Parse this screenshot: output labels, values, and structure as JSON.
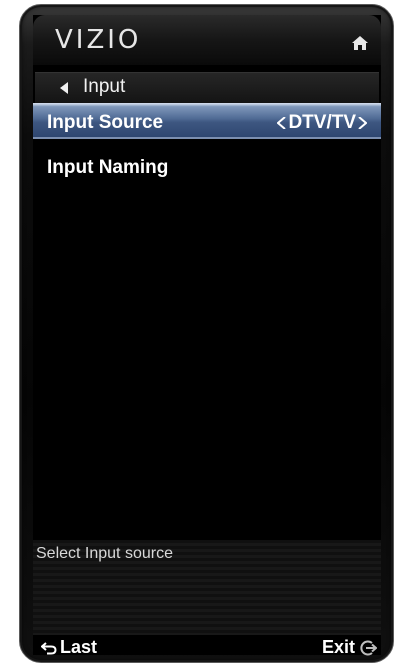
{
  "header": {
    "brand": "VIZIO",
    "home_icon": "home-icon"
  },
  "breadcrumb": {
    "back_icon": "back-arrow-icon",
    "title": "Input"
  },
  "menu": {
    "items": [
      {
        "label": "Input Source",
        "value": "DTV/TV",
        "selected": true
      },
      {
        "label": "Input Naming",
        "selected": false
      }
    ]
  },
  "help": {
    "text": "Select Input source"
  },
  "footer": {
    "last_label": "Last",
    "exit_label": "Exit"
  },
  "colors": {
    "selected_bar": "#4f6a94",
    "background": "#000000",
    "text": "#ffffff"
  }
}
